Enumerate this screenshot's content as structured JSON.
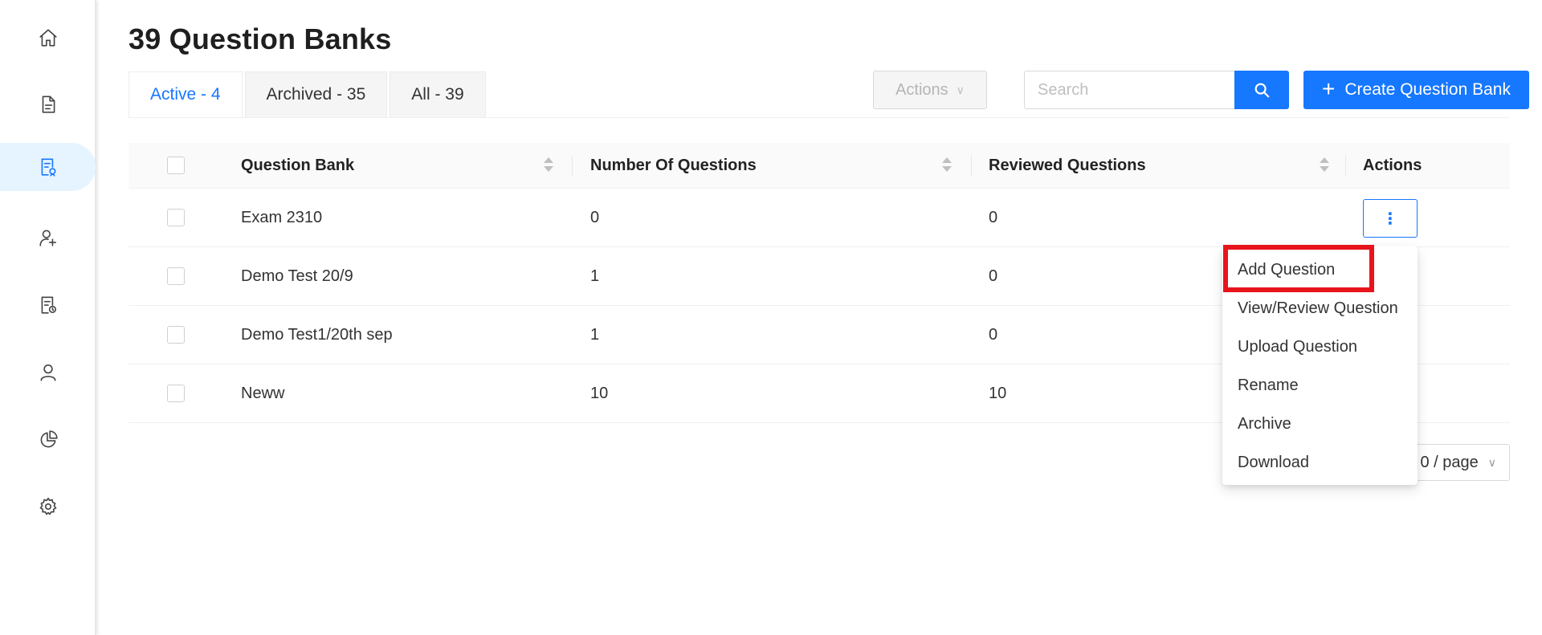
{
  "page": {
    "title": "39 Question Banks"
  },
  "sidebar": {
    "items": [
      {
        "icon": "home-icon"
      },
      {
        "icon": "document-icon"
      },
      {
        "icon": "question-bank-icon",
        "active": true
      },
      {
        "icon": "user-add-icon"
      },
      {
        "icon": "report-icon"
      },
      {
        "icon": "user-icon"
      },
      {
        "icon": "pie-chart-icon"
      },
      {
        "icon": "settings-icon"
      }
    ]
  },
  "tabs": [
    {
      "label": "Active - 4",
      "active": true
    },
    {
      "label": "Archived - 35"
    },
    {
      "label": "All - 39"
    }
  ],
  "toolbar": {
    "actions_label": "Actions",
    "search_placeholder": "Search",
    "create_label": "Create Question Bank"
  },
  "table": {
    "columns": [
      "Question Bank",
      "Number Of Questions",
      "Reviewed Questions",
      "Actions"
    ],
    "rows": [
      {
        "name": "Exam 2310",
        "questions": "0",
        "reviewed": "0"
      },
      {
        "name": "Demo Test 20/9",
        "questions": "1",
        "reviewed": "0"
      },
      {
        "name": "Demo Test1/20th sep",
        "questions": "1",
        "reviewed": "0"
      },
      {
        "name": "Neww",
        "questions": "10",
        "reviewed": "10"
      }
    ]
  },
  "row_menu": {
    "items": [
      "Add Question",
      "View/Review Question",
      "Upload Question",
      "Rename",
      "Archive",
      "Download"
    ]
  },
  "pagination": {
    "page_size": "0 / page"
  },
  "colors": {
    "primary": "#1677ff",
    "highlight": "#e8141c"
  }
}
